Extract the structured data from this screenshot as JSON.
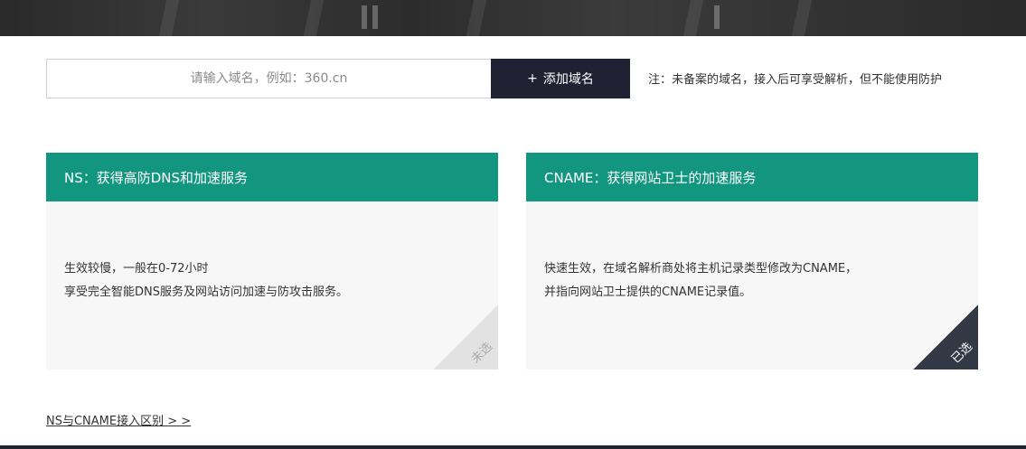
{
  "add_domain": {
    "placeholder": "请输入域名，例如：360.cn",
    "button_plus": "+",
    "button_label": "添加域名",
    "note": "注：未备案的域名，接入后可享受解析，但不能使用防护"
  },
  "cards": [
    {
      "title": "NS：获得高防DNS和加速服务",
      "lines": [
        "生效较慢，一般在0-72小时",
        "享受完全智能DNS服务及网站访问加速与防攻击服务。"
      ],
      "corner_label": "未选",
      "selected": false
    },
    {
      "title": "CNAME：获得网站卫士的加速服务",
      "lines": [
        "快速生效，在域名解析商处将主机记录类型修改为CNAME，",
        "并指向网站卫士提供的CNAME记录值。"
      ],
      "corner_label": "已选",
      "selected": true
    }
  ],
  "diff_link": "NS与CNAME接入区别 > >",
  "colors": {
    "card_header": "#129680",
    "button_bg": "#222033",
    "selected_corner": "#333944",
    "unselected_corner": "#e2e2e2"
  }
}
